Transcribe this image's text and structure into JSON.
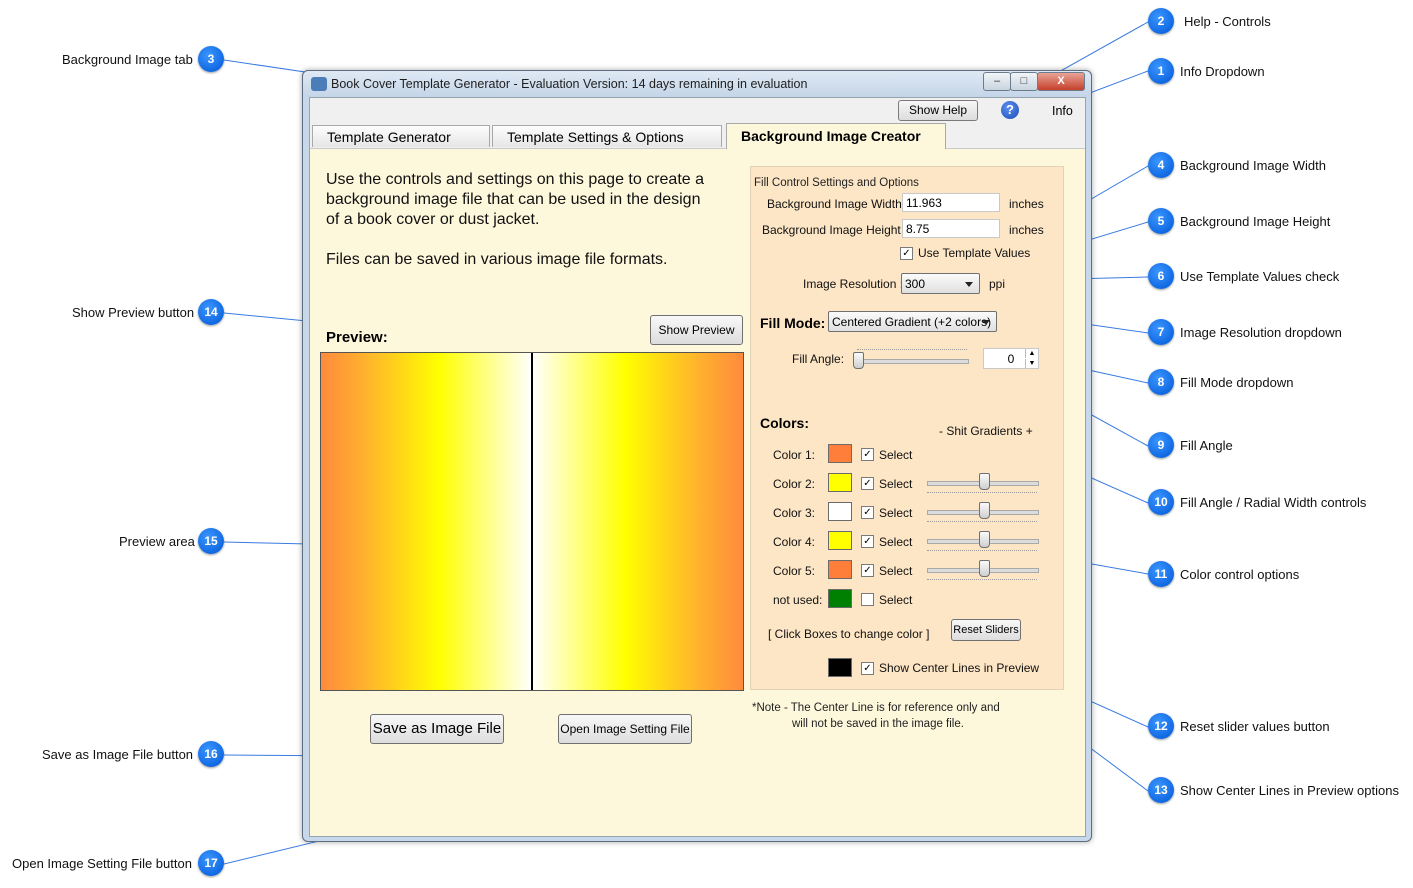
{
  "window": {
    "title": "Book Cover Template Generator - Evaluation Version: 14 days remaining in evaluation",
    "close_glyph": "X",
    "min_glyph": "–",
    "max_glyph": "□"
  },
  "helpbar": {
    "show_help": "Show Help",
    "help_icon": "?",
    "info": "Info"
  },
  "tabs": [
    "Template Generator",
    "Template Settings & Options",
    "Background Image Creator"
  ],
  "intro": {
    "line1": "Use the controls and settings on this page to create a",
    "line2": "background image file that can be used in the  design",
    "line3": "of a book cover or dust jacket.",
    "line4": "Files can be saved in various image file formats."
  },
  "preview": {
    "heading": "Preview:",
    "show_button": "Show Preview"
  },
  "buttons": {
    "save": "Save as Image File",
    "open": "Open Image Setting File"
  },
  "fill": {
    "group_title": "Fill Control Settings and Options",
    "width_label": "Background Image Width :",
    "width_value": "11.963",
    "height_label": "Background Image Height :",
    "height_value": "8.75",
    "unit": "inches",
    "use_template_label": "Use Template Values",
    "resolution_label": "Image Resolution :",
    "resolution_value": "300",
    "resolution_unit": "ppi",
    "mode_label": "Fill Mode:",
    "mode_value": "Centered Gradient (+2 colors)",
    "angle_label": "Fill Angle:",
    "angle_value": "0",
    "colors_heading": "Colors:",
    "shift_label": "-  Shit Gradients  +",
    "colors": [
      {
        "label": "Color 1:",
        "color": "#ff7f3a",
        "select": "Select",
        "checked": "✓"
      },
      {
        "label": "Color 2:",
        "color": "#ffff00",
        "select": "Select",
        "checked": "✓"
      },
      {
        "label": "Color 3:",
        "color": "#ffffff",
        "select": "Select",
        "checked": "✓"
      },
      {
        "label": "Color 4:",
        "color": "#ffff00",
        "select": "Select",
        "checked": "✓"
      },
      {
        "label": "Color 5:",
        "color": "#ff7f3a",
        "select": "Select",
        "checked": "✓"
      },
      {
        "label": "not used:",
        "color": "#008000",
        "select": "Select",
        "checked": ""
      }
    ],
    "click_hint": "[ Click Boxes to change color ]",
    "reset_button": "Reset Sliders",
    "center_lines_label": "Show Center Lines in Preview",
    "center_line_color": "#000000",
    "check_mark": "✓"
  },
  "note": {
    "line1": "*Note -   The Center Line is for reference only and",
    "line2": "will not be saved in the image file."
  },
  "callouts": [
    {
      "num": "1",
      "label": "Info Dropdown"
    },
    {
      "num": "2",
      "label": "Help - Controls"
    },
    {
      "num": "3",
      "label": "Background Image tab"
    },
    {
      "num": "4",
      "label": "Background Image Width"
    },
    {
      "num": "5",
      "label": "Background Image Height"
    },
    {
      "num": "6",
      "label": "Use Template Values check"
    },
    {
      "num": "7",
      "label": "Image Resolution dropdown"
    },
    {
      "num": "8",
      "label": "Fill Mode dropdown"
    },
    {
      "num": "9",
      "label": "Fill Angle"
    },
    {
      "num": "10",
      "label": "Fill Angle / Radial Width controls"
    },
    {
      "num": "11",
      "label": "Color control options"
    },
    {
      "num": "12",
      "label": "Reset slider values button"
    },
    {
      "num": "13",
      "label": "Show Center Lines in Preview options"
    },
    {
      "num": "14",
      "label": "Show Preview button"
    },
    {
      "num": "15",
      "label": "Preview area"
    },
    {
      "num": "16",
      "label": "Save as Image File button"
    },
    {
      "num": "17",
      "label": "Open Image Setting File button"
    }
  ]
}
